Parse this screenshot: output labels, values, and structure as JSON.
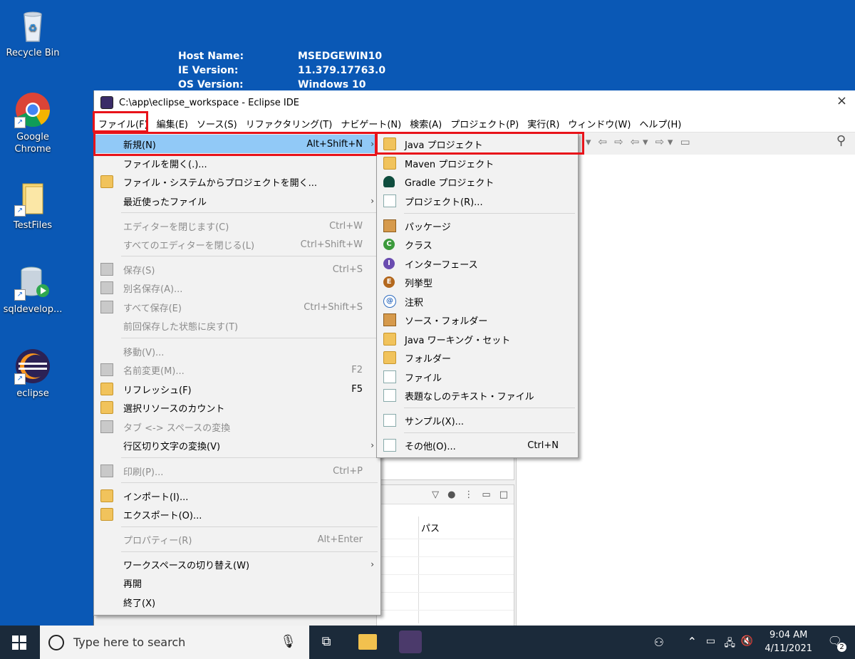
{
  "desktop": {
    "icons": [
      {
        "label": "Recycle Bin",
        "icon": "recycle-bin-icon"
      },
      {
        "label": "Google Chrome",
        "icon": "chrome-icon"
      },
      {
        "label": "TestFiles",
        "icon": "folder-icon"
      },
      {
        "label": "sqldevelop...",
        "icon": "database-icon"
      },
      {
        "label": "eclipse",
        "icon": "eclipse-icon"
      }
    ],
    "bginfo": [
      {
        "key": "Host Name:",
        "value": "MSEDGEWIN10"
      },
      {
        "key": "IE Version:",
        "value": "11.379.17763.0"
      },
      {
        "key": "OS Version:",
        "value": "Windows 10"
      }
    ]
  },
  "window": {
    "title": "C:\\app\\eclipse_workspace - Eclipse IDE",
    "close_glyph": "×",
    "menubar": [
      "ファイル(F)",
      "編集(E)",
      "ソース(S)",
      "リファクタリング(T)",
      "ナビゲート(N)",
      "検索(A)",
      "プロジェクト(P)",
      "実行(R)",
      "ウィンドウ(W)",
      "ヘルプ(H)"
    ],
    "lower_pane_column": "パス"
  },
  "file_menu": {
    "items": [
      {
        "label": "新規(N)",
        "shortcut": "Alt+Shift+N",
        "submenu": true,
        "highlighted": true,
        "disabled": false,
        "icon": "none"
      },
      {
        "label": "ファイルを開く(.)...",
        "shortcut": "",
        "submenu": false,
        "disabled": false,
        "icon": "none"
      },
      {
        "label": "ファイル・システムからプロジェクトを開く...",
        "shortcut": "",
        "submenu": false,
        "disabled": false,
        "icon": "open-folder-icon"
      },
      {
        "label": "最近使ったファイル",
        "shortcut": "",
        "submenu": true,
        "disabled": false,
        "icon": "none"
      },
      {
        "label": "エディターを閉じます(C)",
        "shortcut": "Ctrl+W",
        "submenu": false,
        "disabled": true,
        "icon": "none"
      },
      {
        "label": "すべてのエディターを閉じる(L)",
        "shortcut": "Ctrl+Shift+W",
        "submenu": false,
        "disabled": true,
        "icon": "none"
      },
      {
        "label": "保存(S)",
        "shortcut": "Ctrl+S",
        "submenu": false,
        "disabled": true,
        "icon": "save-icon"
      },
      {
        "label": "別名保存(A)...",
        "shortcut": "",
        "submenu": false,
        "disabled": true,
        "icon": "save-as-icon"
      },
      {
        "label": "すべて保存(E)",
        "shortcut": "Ctrl+Shift+S",
        "submenu": false,
        "disabled": true,
        "icon": "save-all-icon"
      },
      {
        "label": "前回保存した状態に戻す(T)",
        "shortcut": "",
        "submenu": false,
        "disabled": true,
        "icon": "none"
      },
      {
        "label": "移動(V)...",
        "shortcut": "",
        "submenu": false,
        "disabled": true,
        "icon": "none"
      },
      {
        "label": "名前変更(M)...",
        "shortcut": "F2",
        "submenu": false,
        "disabled": true,
        "icon": "rename-icon"
      },
      {
        "label": "リフレッシュ(F)",
        "shortcut": "F5",
        "submenu": false,
        "disabled": false,
        "icon": "refresh-icon"
      },
      {
        "label": "選択リソースのカウント",
        "shortcut": "",
        "submenu": false,
        "disabled": false,
        "icon": "count-icon"
      },
      {
        "label": "タブ <-> スペースの変換",
        "shortcut": "",
        "submenu": false,
        "disabled": true,
        "icon": "convert-icon"
      },
      {
        "label": "行区切り文字の変換(V)",
        "shortcut": "",
        "submenu": true,
        "disabled": false,
        "icon": "none"
      },
      {
        "label": "印刷(P)...",
        "shortcut": "Ctrl+P",
        "submenu": false,
        "disabled": true,
        "icon": "print-icon"
      },
      {
        "label": "インポート(I)...",
        "shortcut": "",
        "submenu": false,
        "disabled": false,
        "icon": "import-icon"
      },
      {
        "label": "エクスポート(O)...",
        "shortcut": "",
        "submenu": false,
        "disabled": false,
        "icon": "export-icon"
      },
      {
        "label": "プロパティー(R)",
        "shortcut": "Alt+Enter",
        "submenu": false,
        "disabled": true,
        "icon": "none"
      },
      {
        "label": "ワークスペースの切り替え(W)",
        "shortcut": "",
        "submenu": true,
        "disabled": false,
        "icon": "none"
      },
      {
        "label": "再開",
        "shortcut": "",
        "submenu": false,
        "disabled": false,
        "icon": "none"
      },
      {
        "label": "終了(X)",
        "shortcut": "",
        "submenu": false,
        "disabled": false,
        "icon": "none"
      }
    ]
  },
  "new_menu": {
    "items": [
      {
        "label": "Java プロジェクト",
        "shortcut": "",
        "icon": "java-project-icon"
      },
      {
        "label": "Maven プロジェクト",
        "shortcut": "",
        "icon": "maven-project-icon"
      },
      {
        "label": "Gradle プロジェクト",
        "shortcut": "",
        "icon": "gradle-project-icon"
      },
      {
        "label": "プロジェクト(R)...",
        "shortcut": "",
        "icon": "project-icon"
      },
      {
        "label": "パッケージ",
        "shortcut": "",
        "icon": "package-icon"
      },
      {
        "label": "クラス",
        "shortcut": "",
        "icon": "class-icon"
      },
      {
        "label": "インターフェース",
        "shortcut": "",
        "icon": "interface-icon"
      },
      {
        "label": "列挙型",
        "shortcut": "",
        "icon": "enum-icon"
      },
      {
        "label": "注釈",
        "shortcut": "",
        "icon": "annotation-icon"
      },
      {
        "label": "ソース・フォルダー",
        "shortcut": "",
        "icon": "source-folder-icon"
      },
      {
        "label": "Java ワーキング・セット",
        "shortcut": "",
        "icon": "working-set-icon"
      },
      {
        "label": "フォルダー",
        "shortcut": "",
        "icon": "folder-icon"
      },
      {
        "label": "ファイル",
        "shortcut": "",
        "icon": "file-icon"
      },
      {
        "label": "表題なしのテキスト・ファイル",
        "shortcut": "",
        "icon": "text-file-icon"
      },
      {
        "label": "サンプル(X)...",
        "shortcut": "",
        "icon": "example-icon"
      },
      {
        "label": "その他(O)...",
        "shortcut": "Ctrl+N",
        "icon": "other-wizard-icon"
      }
    ]
  },
  "taskbar": {
    "search_placeholder": "Type here to search",
    "time": "9:04 AM",
    "date": "4/11/2021",
    "notification_count": "2"
  },
  "colors": {
    "desktop": "#0a58b5",
    "menu_highlight": "#91c9f7",
    "annotation_red": "#e8131a",
    "taskbar": "#1b2a3a"
  }
}
